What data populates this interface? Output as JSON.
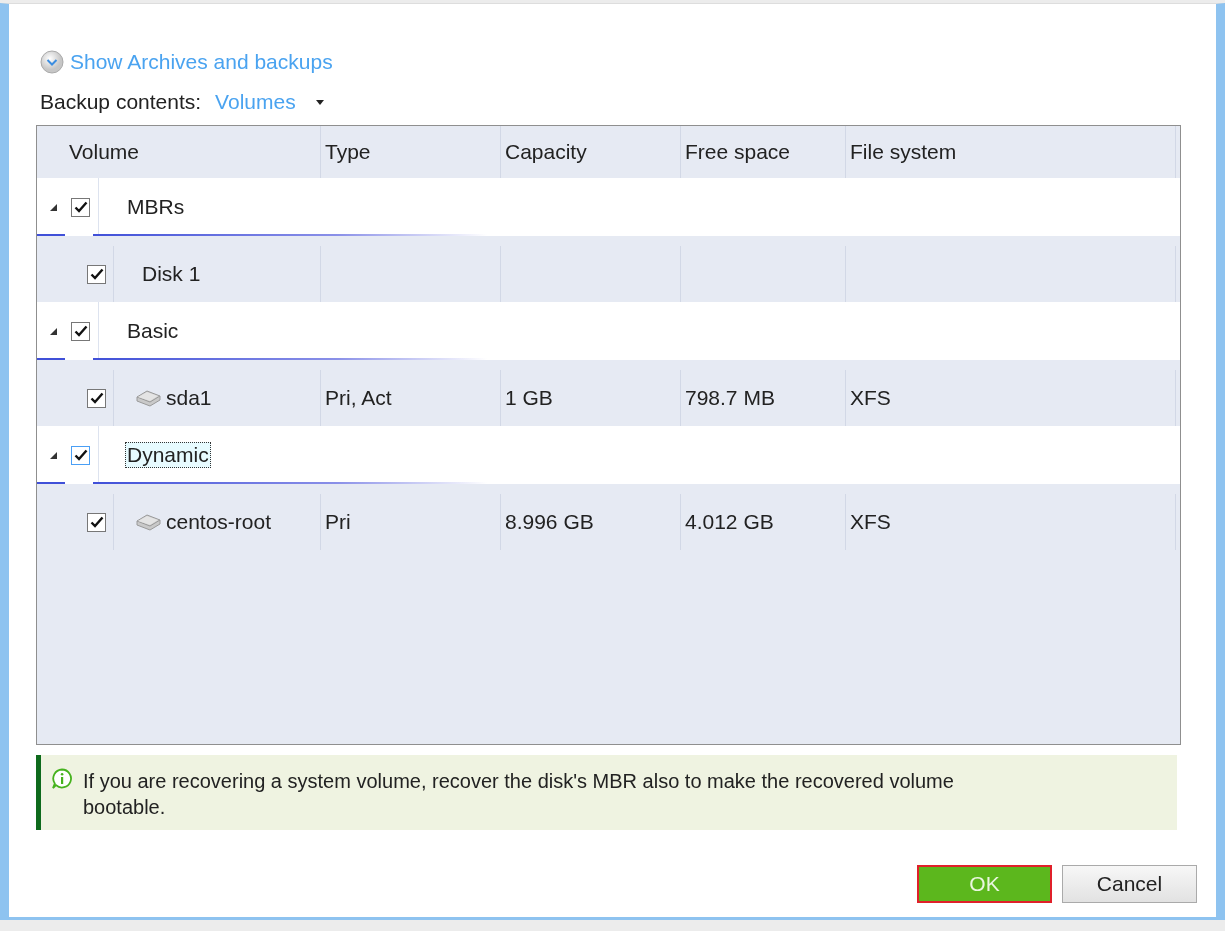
{
  "archives_toggle": {
    "label": "Show Archives and backups"
  },
  "backup_contents": {
    "label": "Backup contents:",
    "value": "Volumes"
  },
  "table": {
    "columns": [
      "Volume",
      "Type",
      "Capacity",
      "Free space",
      "File system"
    ],
    "groups": [
      {
        "name": "MBRs",
        "checked": true,
        "expanded": true,
        "focused": false,
        "children": [
          {
            "kind": "disk",
            "volume": "Disk 1",
            "checked": true
          }
        ]
      },
      {
        "name": "Basic",
        "checked": true,
        "expanded": true,
        "focused": false,
        "children": [
          {
            "kind": "volume",
            "volume": "sda1",
            "type": "Pri, Act",
            "capacity": "1 GB",
            "free_space": "798.7 MB",
            "file_system": "XFS",
            "checked": true
          }
        ]
      },
      {
        "name": "Dynamic",
        "checked": true,
        "expanded": true,
        "focused": true,
        "children": [
          {
            "kind": "volume",
            "volume": "centos-root",
            "type": "Pri",
            "capacity": "8.996 GB",
            "free_space": "4.012 GB",
            "file_system": "XFS",
            "checked": true
          }
        ]
      }
    ]
  },
  "note": "If you are recovering a system volume, recover the disk's MBR also to make the recovered volume bootable.",
  "buttons": [
    {
      "label": "OK",
      "kind": "primary"
    },
    {
      "label": "Cancel",
      "kind": "secondary"
    }
  ]
}
